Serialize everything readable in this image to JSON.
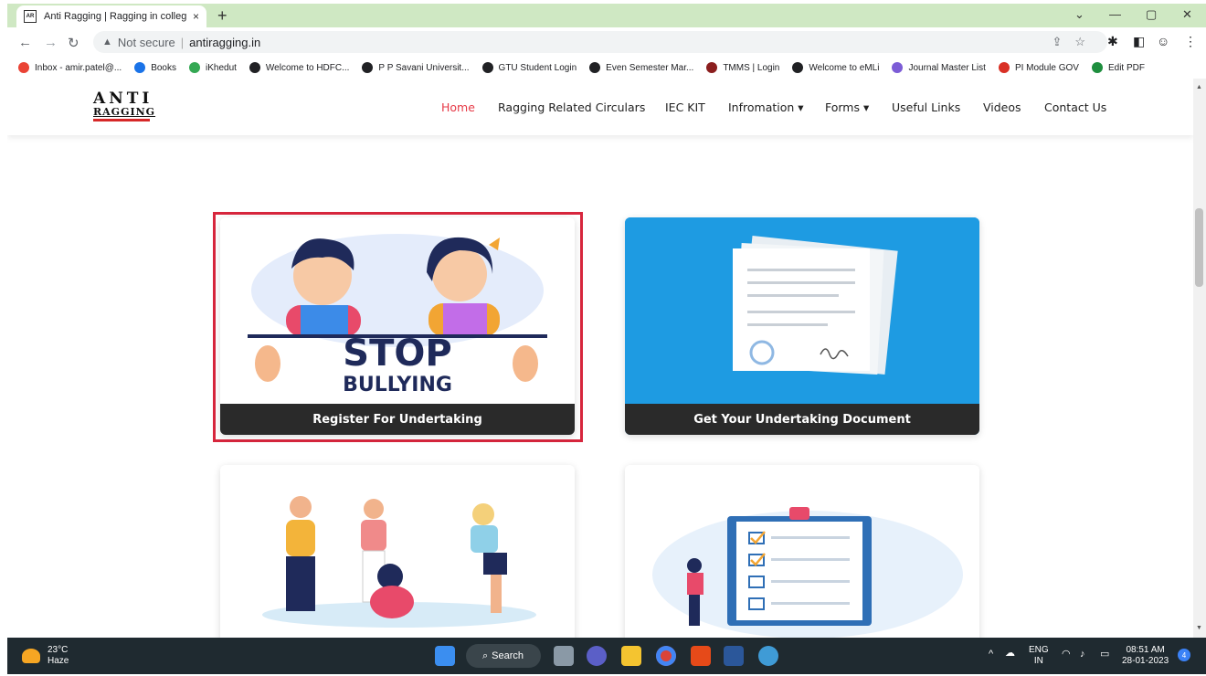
{
  "browser": {
    "tab_title": "Anti Ragging | Ragging in colleg",
    "tab_close": "×",
    "new_tab": "+",
    "window_controls": [
      "⌄",
      "—",
      "▢",
      "✕"
    ],
    "security_label": "Not secure",
    "url": "antiragging.in"
  },
  "bookmarks": [
    {
      "label": "Inbox - amir.patel@...",
      "icon": "gmail-icon",
      "color": "#ea4335"
    },
    {
      "label": "Books",
      "icon": "books-icon",
      "color": "#1a73e8"
    },
    {
      "label": "iKhedut",
      "icon": "ikhedut-icon",
      "color": "#34a853"
    },
    {
      "label": "Welcome to HDFC...",
      "icon": "globe-icon",
      "color": "#202124"
    },
    {
      "label": "P P Savani Universit...",
      "icon": "globe-icon",
      "color": "#202124"
    },
    {
      "label": "GTU Student Login",
      "icon": "globe-icon",
      "color": "#202124"
    },
    {
      "label": "Even Semester Mar...",
      "icon": "globe-icon",
      "color": "#202124"
    },
    {
      "label": "TMMS | Login",
      "icon": "tmms-icon",
      "color": "#8b1e1e"
    },
    {
      "label": "Welcome to eMLi",
      "icon": "globe-icon",
      "color": "#202124"
    },
    {
      "label": "Journal Master List",
      "icon": "journal-icon",
      "color": "#7c5cd6"
    },
    {
      "label": "PI Module GOV",
      "icon": "pi-icon",
      "color": "#d93025"
    },
    {
      "label": "Edit PDF",
      "icon": "edit-pdf-icon",
      "color": "#1e8e3e"
    }
  ],
  "site": {
    "logo_top": "ANTI",
    "logo_bottom": "RAGGING",
    "nav": [
      {
        "label": "Home",
        "active": true
      },
      {
        "label": "Ragging Related Circulars",
        "active": false
      },
      {
        "label": "IEC KIT",
        "active": false
      },
      {
        "label": "Infromation ▾",
        "active": false
      },
      {
        "label": "Forms ▾",
        "active": false
      },
      {
        "label": "Useful Links",
        "active": false
      },
      {
        "label": "Videos",
        "active": false
      },
      {
        "label": "Contact Us",
        "active": false
      }
    ],
    "cards": [
      {
        "caption": "Register For Undertaking",
        "image_text_1": "STOP",
        "image_text_2": "BULLYING"
      },
      {
        "caption": "Get Your Undertaking Document"
      }
    ],
    "scroll_top": "↑"
  },
  "taskbar": {
    "temperature": "23°C",
    "condition": "Haze",
    "search_label": "Search",
    "lang_1": "ENG",
    "lang_2": "IN",
    "time": "08:51 AM",
    "date": "28-01-2023",
    "notification_count": "4"
  },
  "colors": {
    "accent_red": "#e63946",
    "card_blue": "#1e9be2",
    "caption_dark": "#2a2a2a",
    "browser_frame": "#cfe8c3"
  }
}
